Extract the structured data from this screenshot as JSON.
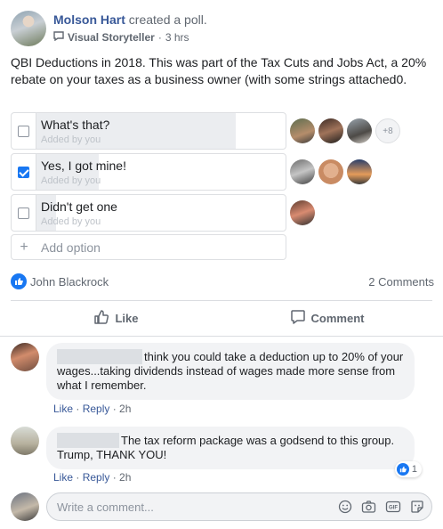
{
  "post": {
    "author": "Molson Hart",
    "action": " created a poll.",
    "group": "Visual Storyteller",
    "time": "3 hrs",
    "question": "QBI Deductions in 2018. This was part of the Tax Cuts and Jobs Act, a 20% rebate on your taxes as a business owner (with some strings attached0."
  },
  "poll": {
    "options": [
      {
        "label": "What's that?",
        "added_by": "Added by you",
        "checked": false,
        "vote_share": 0.8,
        "more_voters": "+8"
      },
      {
        "label": "Yes, I got mine!",
        "added_by": "Added by you",
        "checked": true,
        "vote_share": 0.25
      },
      {
        "label": "Didn't get one",
        "added_by": "Added by you",
        "checked": false,
        "vote_share": 0.08
      }
    ],
    "add_option_placeholder": "Add option"
  },
  "reactions": {
    "reactor_name": "John Blackrock",
    "comments_count": "2 Comments"
  },
  "actions": {
    "like_label": "Like",
    "comment_label": "Comment"
  },
  "comments": [
    {
      "text": "think you could take a deduction up to 20% of your wages...taking dividends instead of wages made more sense from what I remember.",
      "like_label": "Like",
      "reply_label": "Reply",
      "time": "2h"
    },
    {
      "text": "The tax reform package was a godsend to this group. Trump, THANK YOU!",
      "like_label": "Like",
      "reply_label": "Reply",
      "time": "2h",
      "reaction_count": "1"
    }
  ],
  "composer": {
    "placeholder": "Write a comment..."
  },
  "colors": {
    "accent": "#1877f2",
    "link": "#385898",
    "muted": "#606770"
  }
}
